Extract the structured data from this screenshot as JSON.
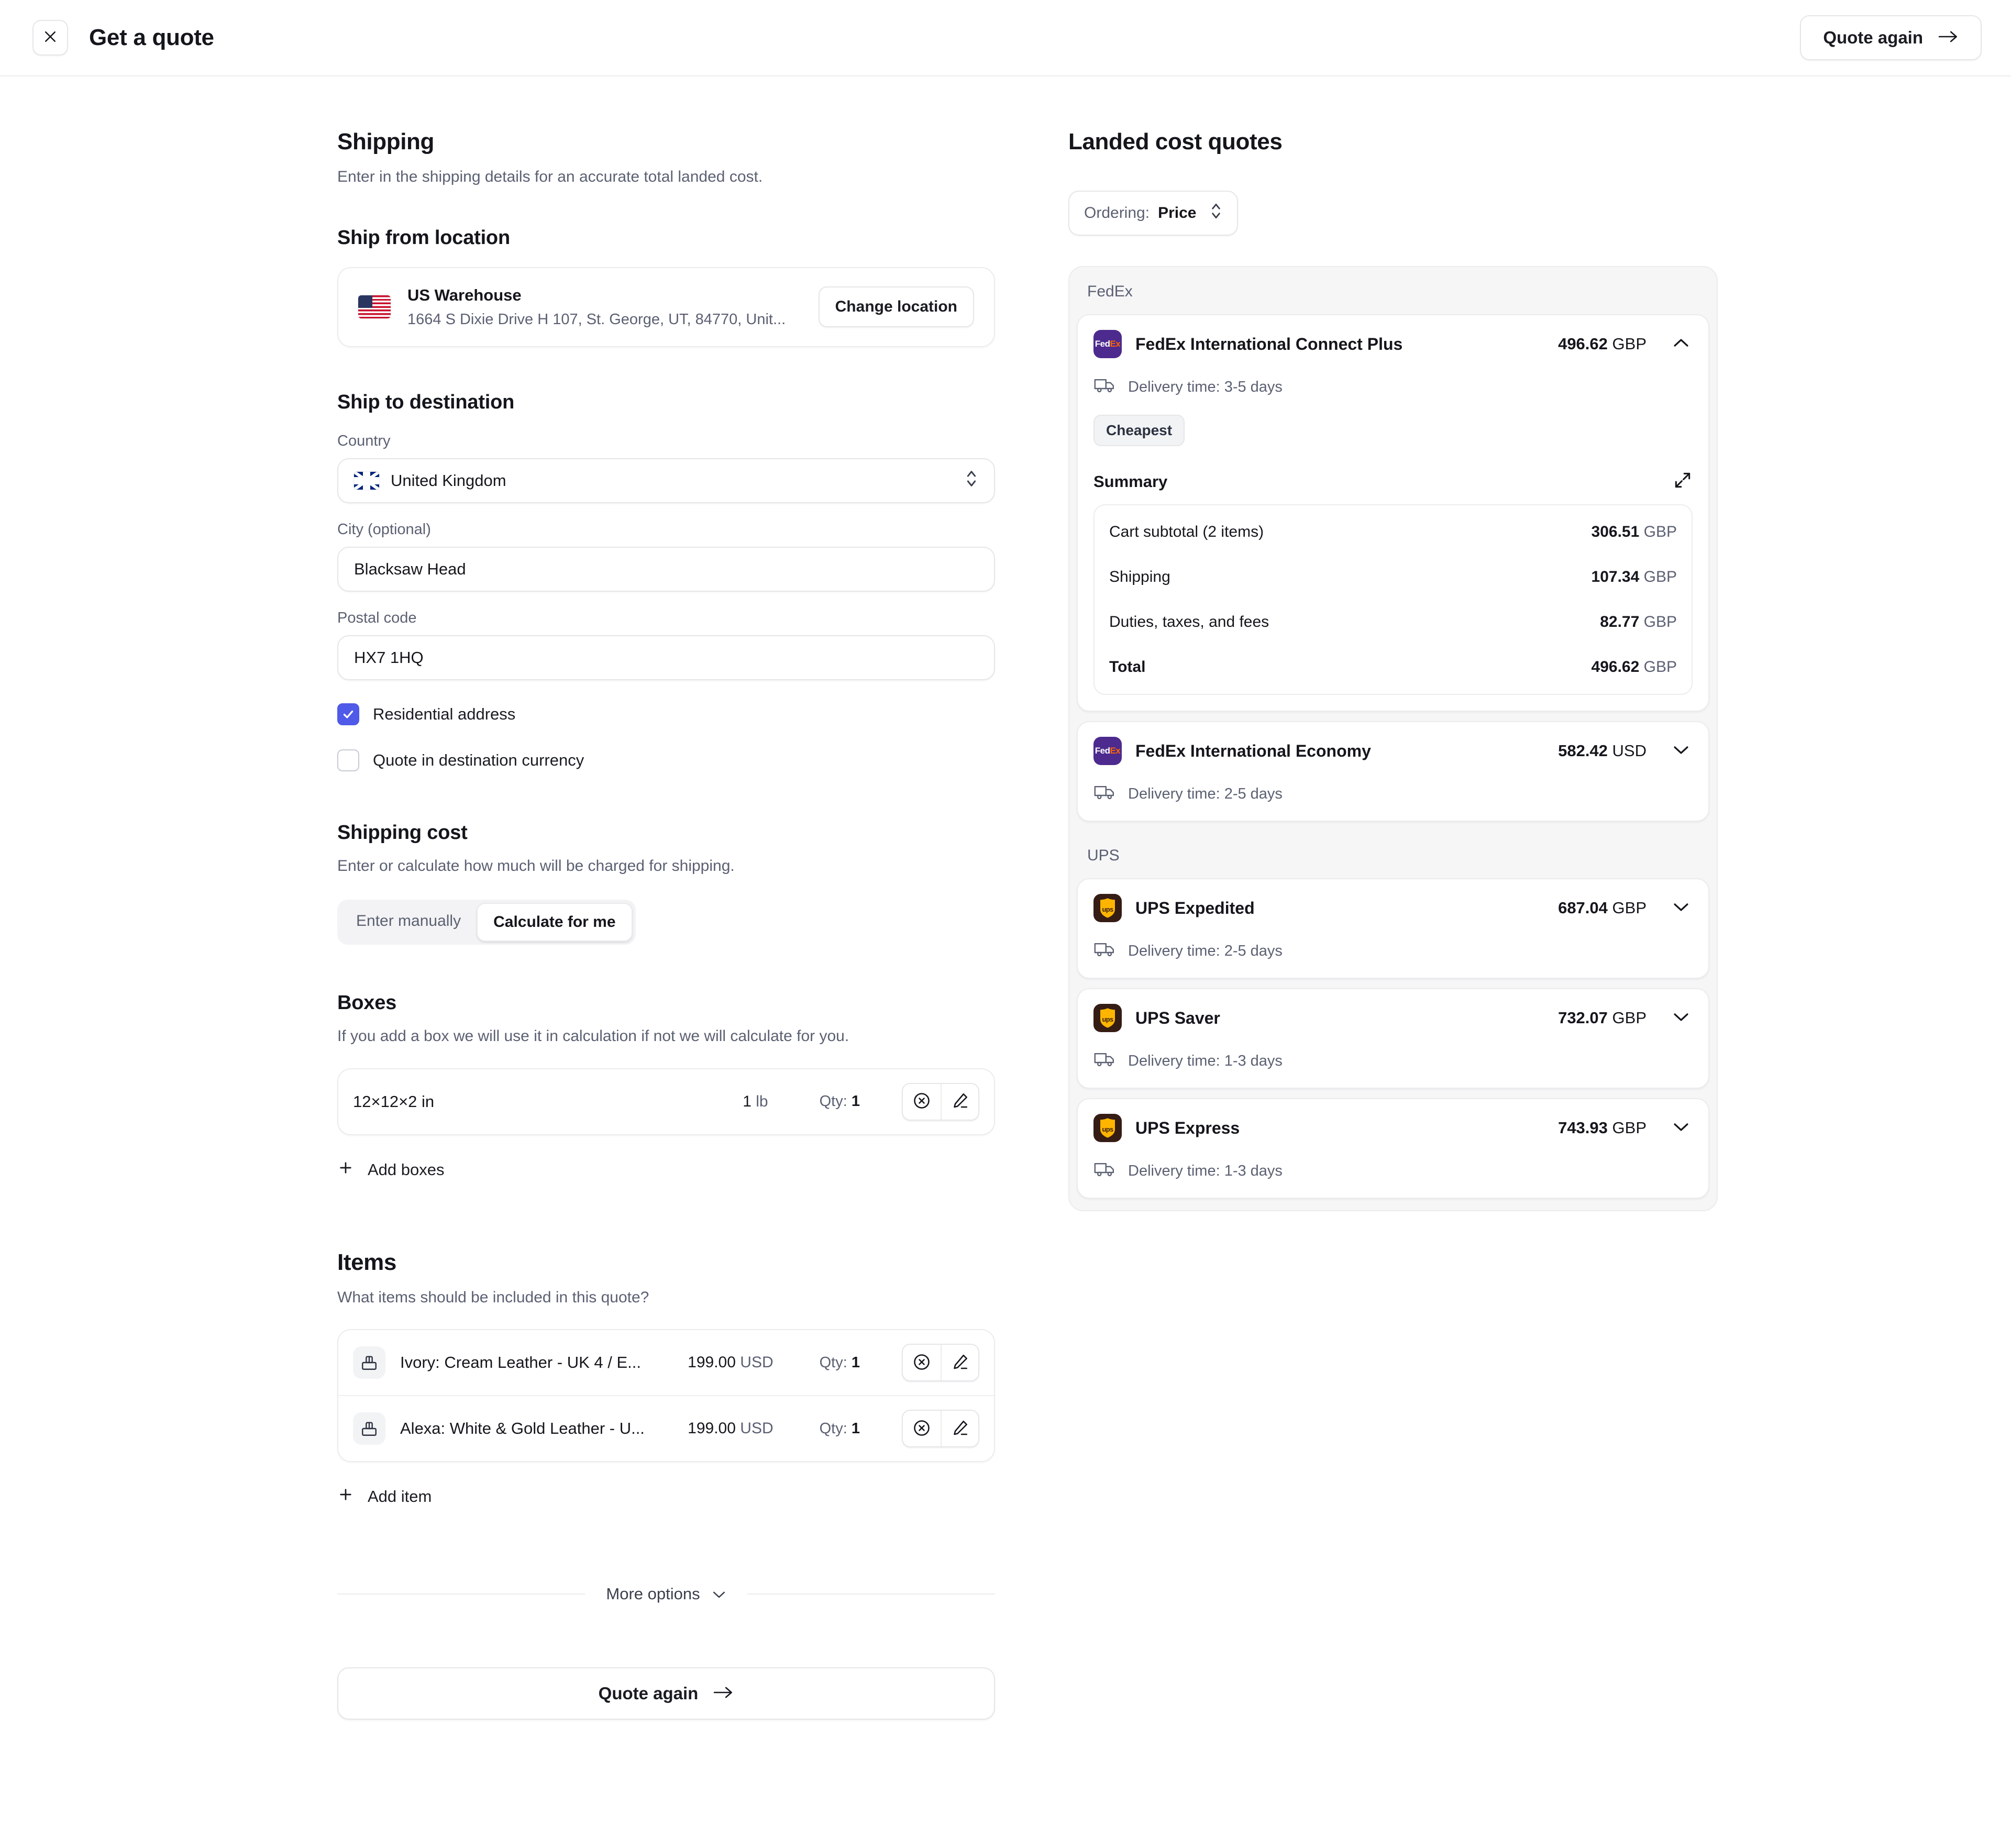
{
  "topbar": {
    "close_icon": "close-icon",
    "title": "Get a quote",
    "quote_again_label": "Quote again"
  },
  "shipping": {
    "title": "Shipping",
    "subtitle": "Enter in the shipping details for an accurate total landed cost.",
    "ship_from": {
      "title": "Ship from location",
      "flag": "us-flag",
      "name": "US Warehouse",
      "address": "1664 S Dixie Drive H 107, St. George, UT, 84770, Unit...",
      "change_label": "Change location"
    },
    "ship_to": {
      "title": "Ship to destination",
      "country_label": "Country",
      "country_value": "United Kingdom",
      "country_flag": "uk-flag",
      "city_label": "City (optional)",
      "city_value": "Blacksaw Head",
      "city_placeholder": "City",
      "postal_label": "Postal code",
      "postal_value": "HX7 1HQ",
      "postal_placeholder": "Postal code",
      "residential_label": "Residential address",
      "residential_checked": true,
      "destination_currency_label": "Quote in destination currency",
      "destination_currency_checked": false
    },
    "shipping_cost": {
      "title": "Shipping cost",
      "subtitle": "Enter or calculate how much will be charged for shipping.",
      "options": [
        "Enter manually",
        "Calculate for me"
      ],
      "selected": "Calculate for me"
    },
    "boxes": {
      "title": "Boxes",
      "subtitle": "If you add a box we will use it in calculation if not we will calculate for you.",
      "rows": [
        {
          "dimensions": "12×12×2 in",
          "weight": "1",
          "weight_unit": "lb",
          "qty_label": "Qty:",
          "qty": "1"
        }
      ],
      "add_label": "Add boxes"
    },
    "items": {
      "title": "Items",
      "subtitle": "What items should be included in this quote?",
      "rows": [
        {
          "name": "Ivory: Cream Leather - UK 4 / E...",
          "price": "199.00",
          "currency": "USD",
          "qty_label": "Qty:",
          "qty": "1"
        },
        {
          "name": "Alexa: White & Gold Leather - U...",
          "price": "199.00",
          "currency": "USD",
          "qty_label": "Qty:",
          "qty": "1"
        }
      ],
      "add_label": "Add item"
    },
    "more_options_label": "More options",
    "quote_again_label": "Quote again"
  },
  "quotes": {
    "title": "Landed cost quotes",
    "ordering_label": "Ordering:",
    "ordering_value": "Price",
    "groups": [
      {
        "carrier": "FedEx",
        "logo": "fedex-logo",
        "cards": [
          {
            "name": "FedEx International Connect Plus",
            "price": "496.62",
            "currency": "GBP",
            "expanded": true,
            "chevron": "chevron-up-icon",
            "delivery": "Delivery time: 3-5 days",
            "badge": "Cheapest",
            "summary_title": "Summary",
            "summary": [
              {
                "label": "Cart subtotal (2 items)",
                "value": "306.51",
                "currency": "GBP",
                "total": false
              },
              {
                "label": "Shipping",
                "value": "107.34",
                "currency": "GBP",
                "total": false
              },
              {
                "label": "Duties, taxes, and fees",
                "value": "82.77",
                "currency": "GBP",
                "total": false
              },
              {
                "label": "Total",
                "value": "496.62",
                "currency": "GBP",
                "total": true
              }
            ]
          },
          {
            "name": "FedEx International Economy",
            "price": "582.42",
            "currency": "USD",
            "expanded": false,
            "chevron": "chevron-down-icon",
            "delivery": "Delivery time: 2-5 days"
          }
        ]
      },
      {
        "carrier": "UPS",
        "logo": "ups-logo",
        "cards": [
          {
            "name": "UPS Expedited",
            "price": "687.04",
            "currency": "GBP",
            "expanded": false,
            "chevron": "chevron-down-icon",
            "delivery": "Delivery time: 2-5 days"
          },
          {
            "name": "UPS Saver",
            "price": "732.07",
            "currency": "GBP",
            "expanded": false,
            "chevron": "chevron-down-icon",
            "delivery": "Delivery time: 1-3 days"
          },
          {
            "name": "UPS Express",
            "price": "743.93",
            "currency": "GBP",
            "expanded": false,
            "chevron": "chevron-down-icon",
            "delivery": "Delivery time: 1-3 days"
          }
        ]
      }
    ]
  },
  "colors": {
    "accent_checkbox": "#4f5ae8",
    "fedex_purple": "#4d2a8e",
    "fedex_orange": "#ff6600",
    "ups_brown": "#351c15",
    "ups_gold": "#ffb500",
    "panel_bg": "#f6f6f7",
    "border": "#ececee"
  }
}
